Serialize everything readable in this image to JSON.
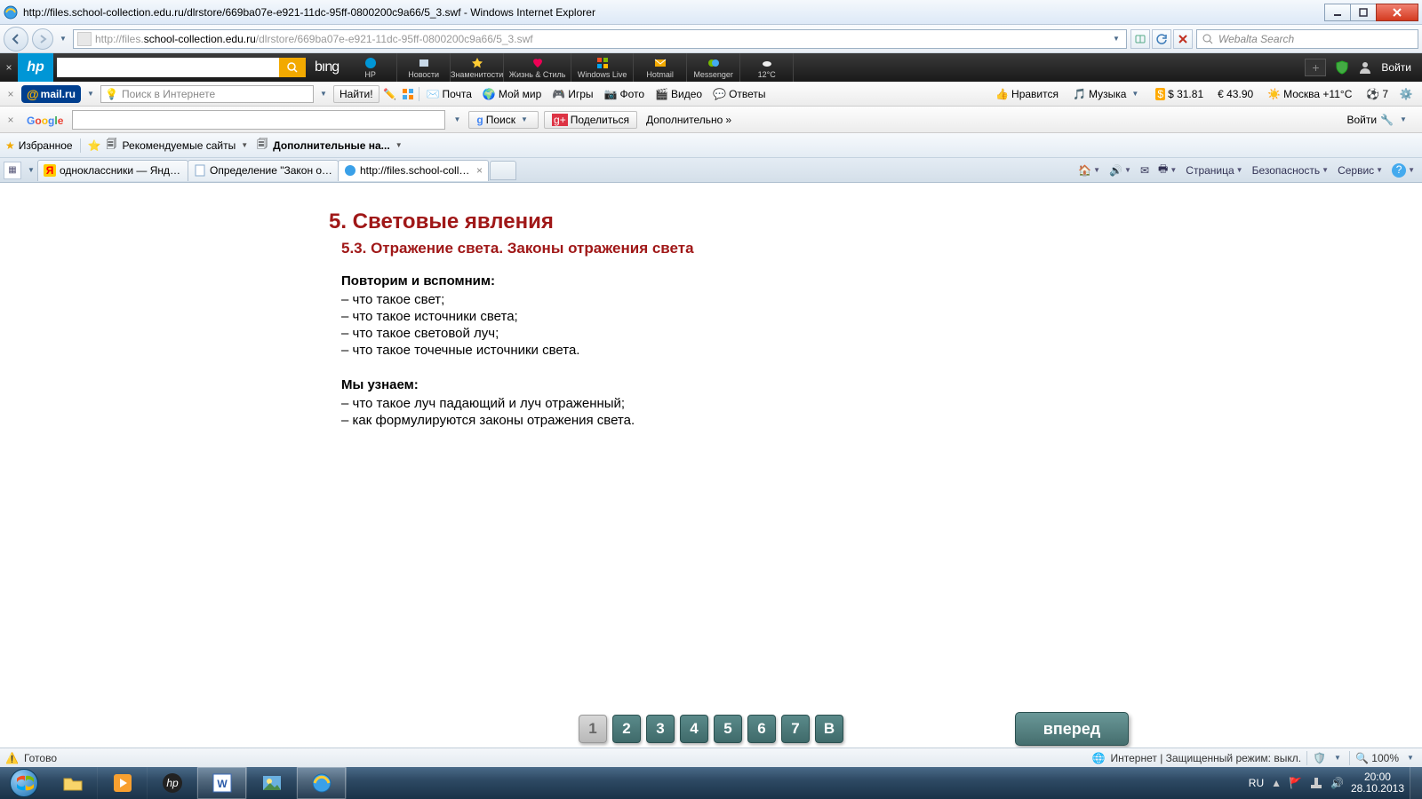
{
  "window": {
    "title": "http://files.school-collection.edu.ru/dlrstore/669ba07e-e921-11dc-95ff-0800200c9a66/5_3.swf - Windows Internet Explorer",
    "url_prefix": "http://files.",
    "url_bold": "school-collection.edu.ru",
    "url_suffix": "/dlrstore/669ba07e-e921-11dc-95ff-0800200c9a66/5_3.swf",
    "search_placeholder": "Webalta Search"
  },
  "hp": {
    "items": [
      "HP",
      "Новости",
      "Знаменитости",
      "Жизнь & Стиль",
      "Windows Live",
      "Hotmail",
      "Messenger",
      "12°C"
    ],
    "login": "Войти"
  },
  "mail": {
    "logo": "mail.ru",
    "search_placeholder": "Поиск в Интернете",
    "find": "Найти!",
    "items": [
      "Почта",
      "Мой мир",
      "Игры",
      "Фото",
      "Видео",
      "Ответы"
    ],
    "like": "Нравится",
    "music": "Музыка",
    "usd": "$ 31.81",
    "eur": "€ 43.90",
    "weather": "Москва +11°C",
    "mailcount": "7"
  },
  "google": {
    "search": "Поиск",
    "share": "Поделиться",
    "more": "Дополнительно",
    "login": "Войти"
  },
  "fav": {
    "favorites": "Избранное",
    "rec_sites": "Рекомендуемые сайты",
    "addons": "Дополнительные на..."
  },
  "tabs": [
    {
      "label": "одноклассники — Яндекс...",
      "icon": "ya"
    },
    {
      "label": "Определение \"Закон отр...",
      "icon": "doc"
    },
    {
      "label": "http://files.school-colle...",
      "icon": "ie",
      "active": true
    }
  ],
  "tabtools": {
    "page": "Страница",
    "security": "Безопасность",
    "service": "Сервис"
  },
  "content": {
    "h1": "5. Световые явления",
    "h2": "5.3. Отражение света. Законы отражения света",
    "sec1_title": "Повторим и вспомним:",
    "sec1": [
      "– что такое свет;",
      "– что такое источники света;",
      "– что такое световой луч;",
      "– что такое точечные источники света."
    ],
    "sec2_title": "Мы узнаем:",
    "sec2": [
      "– что такое луч падающий и луч отраженный;",
      "– как формулируются законы отражения света."
    ]
  },
  "pager": {
    "buttons": [
      "1",
      "2",
      "3",
      "4",
      "5",
      "6",
      "7",
      "В"
    ],
    "forward": "вперед"
  },
  "status": {
    "ready": "Готово",
    "zone": "Интернет | Защищенный режим: выкл.",
    "zoom": "100%"
  },
  "tray": {
    "lang": "RU",
    "time": "20:00",
    "date": "28.10.2013"
  }
}
